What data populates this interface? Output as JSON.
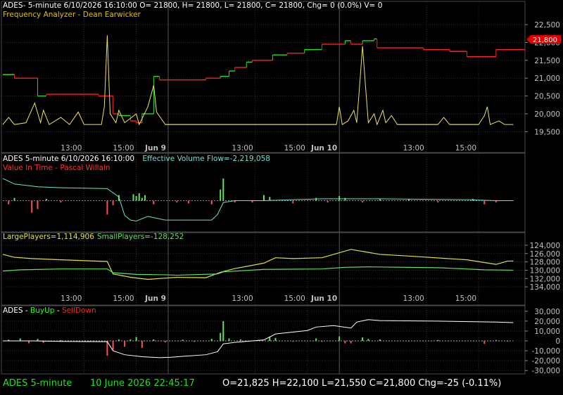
{
  "panels": {
    "p1": {
      "header": "ADES- 5-minute 6/10/2026 16:10:00 O= 21800, H= 21800, L= 21800, C= 21800, Chg= 0 (0.0%) V= 0",
      "indicator_label": "Frequency Analyzer - Dean Earwicker",
      "price_badge": "21,800"
    },
    "p2": {
      "header_prefix": "ADES 5-minute  6/10/2026 16:10:00",
      "header_indicator": "Effective Volume Flow=-2,219,058",
      "indicator_label": "Value In Time - Pascal Willain"
    },
    "p3": {
      "large_label": "LargePlayers=1,114,906",
      "small_label": "SmallPlayers=-128,252"
    },
    "p4": {
      "name": "ADES - ",
      "buy_label": "BuyUp",
      "dash": "-",
      "sell_label": "SellDown"
    }
  },
  "status_bar": {
    "symbol": "ADES  5-minute",
    "datetime": "10 June 2026 22:45:17",
    "ohlc": "O=21,825  H=22,100  L=21,550  C=21,800  Chg=-25 (-0.11%)"
  },
  "colors": {
    "background": "#000000",
    "grid": "#333333",
    "axis_text": "#c0c0c0",
    "price_red": "#ff2020",
    "price_green": "#20e020",
    "oscillator_yellow": "#f0e060",
    "label_yellow": "#e0c000",
    "volume_flow_cyan": "#70e0d0",
    "value_in_time_red": "#ff3030",
    "large_players_yellow": "#e0e040",
    "small_players_green": "#60e060",
    "buyup_green": "#20ff20",
    "selldown_red": "#ff2020",
    "bar_green": "#60e060",
    "bar_red": "#ff5050",
    "white_line": "#ffffff"
  },
  "chart_data": [
    {
      "type": "line",
      "name": "price-panel",
      "ylim": [
        19250,
        22600
      ],
      "y_ticks": [
        "22,500",
        "22,000",
        "21,500",
        "21,000",
        "20,500",
        "20,000",
        "19,500"
      ],
      "y_tick_values": [
        22500,
        22000,
        21500,
        21000,
        20500,
        20000,
        19500
      ],
      "x_ticks": [
        "13:00",
        "15:00",
        "Jun 9",
        "13:00",
        "15:00",
        "Jun 10",
        "13:00",
        "15:00"
      ],
      "x_tick_bars": [
        28,
        46,
        57,
        87,
        105,
        116,
        146,
        164
      ],
      "n_bars": 180,
      "day_boundaries": [
        57,
        116
      ],
      "price_steps": [
        {
          "x": 0,
          "y": 21100,
          "c": "green"
        },
        {
          "x": 4,
          "y": 21000,
          "c": "red"
        },
        {
          "x": 12,
          "y": 20500,
          "c": "green"
        },
        {
          "x": 15,
          "y": 20550,
          "c": "red"
        },
        {
          "x": 33,
          "y": 20500,
          "c": "red"
        },
        {
          "x": 38,
          "y": 20000,
          "c": "red"
        },
        {
          "x": 40,
          "y": 19950,
          "c": "green"
        },
        {
          "x": 44,
          "y": 19800,
          "c": "red"
        },
        {
          "x": 46,
          "y": 19750,
          "c": "red"
        },
        {
          "x": 48,
          "y": 20000,
          "c": "green"
        },
        {
          "x": 52,
          "y": 21050,
          "c": "green"
        },
        {
          "x": 54,
          "y": 20950,
          "c": "red"
        },
        {
          "x": 62,
          "y": 20950,
          "c": "red"
        },
        {
          "x": 70,
          "y": 21000,
          "c": "red"
        },
        {
          "x": 75,
          "y": 21050,
          "c": "green"
        },
        {
          "x": 78,
          "y": 21200,
          "c": "green"
        },
        {
          "x": 80,
          "y": 21300,
          "c": "red"
        },
        {
          "x": 84,
          "y": 21450,
          "c": "green"
        },
        {
          "x": 86,
          "y": 21500,
          "c": "red"
        },
        {
          "x": 93,
          "y": 21650,
          "c": "green"
        },
        {
          "x": 98,
          "y": 21700,
          "c": "red"
        },
        {
          "x": 104,
          "y": 21800,
          "c": "green"
        },
        {
          "x": 110,
          "y": 21950,
          "c": "red"
        },
        {
          "x": 118,
          "y": 22050,
          "c": "green"
        },
        {
          "x": 120,
          "y": 21950,
          "c": "red"
        },
        {
          "x": 124,
          "y": 22050,
          "c": "green"
        },
        {
          "x": 128,
          "y": 22100,
          "c": "green"
        },
        {
          "x": 129,
          "y": 21850,
          "c": "red"
        },
        {
          "x": 145,
          "y": 21800,
          "c": "red"
        },
        {
          "x": 154,
          "y": 21750,
          "c": "red"
        },
        {
          "x": 160,
          "y": 21600,
          "c": "red"
        },
        {
          "x": 170,
          "y": 21800,
          "c": "red"
        },
        {
          "x": 180,
          "y": 21800,
          "c": "red"
        }
      ],
      "oscillator_spikes": [
        {
          "x": 0,
          "y": 19700
        },
        {
          "x": 2,
          "y": 19900
        },
        {
          "x": 4,
          "y": 19700
        },
        {
          "x": 8,
          "y": 19750
        },
        {
          "x": 11,
          "y": 20300
        },
        {
          "x": 13,
          "y": 19750
        },
        {
          "x": 14,
          "y": 20100
        },
        {
          "x": 16,
          "y": 19700
        },
        {
          "x": 20,
          "y": 19900
        },
        {
          "x": 23,
          "y": 19700
        },
        {
          "x": 26,
          "y": 20050
        },
        {
          "x": 28,
          "y": 19700
        },
        {
          "x": 34,
          "y": 19700
        },
        {
          "x": 35,
          "y": 20200
        },
        {
          "x": 36,
          "y": 22200
        },
        {
          "x": 37,
          "y": 20000
        },
        {
          "x": 39,
          "y": 19750
        },
        {
          "x": 40,
          "y": 20100
        },
        {
          "x": 42,
          "y": 19750
        },
        {
          "x": 46,
          "y": 20000
        },
        {
          "x": 47,
          "y": 19700
        },
        {
          "x": 50,
          "y": 20200
        },
        {
          "x": 52,
          "y": 20800
        },
        {
          "x": 53,
          "y": 20050
        },
        {
          "x": 56,
          "y": 19700
        },
        {
          "x": 115,
          "y": 19700
        },
        {
          "x": 116,
          "y": 20200
        },
        {
          "x": 117,
          "y": 19700
        },
        {
          "x": 119,
          "y": 19800
        },
        {
          "x": 121,
          "y": 20100
        },
        {
          "x": 122,
          "y": 19750
        },
        {
          "x": 123,
          "y": 20800
        },
        {
          "x": 124,
          "y": 21900
        },
        {
          "x": 125,
          "y": 20800
        },
        {
          "x": 126,
          "y": 19750
        },
        {
          "x": 128,
          "y": 20000
        },
        {
          "x": 129,
          "y": 19700
        },
        {
          "x": 131,
          "y": 20100
        },
        {
          "x": 132,
          "y": 19750
        },
        {
          "x": 134,
          "y": 19950
        },
        {
          "x": 136,
          "y": 19700
        },
        {
          "x": 150,
          "y": 19700
        },
        {
          "x": 152,
          "y": 19900
        },
        {
          "x": 154,
          "y": 19700
        },
        {
          "x": 164,
          "y": 19700
        },
        {
          "x": 166,
          "y": 19950
        },
        {
          "x": 167,
          "y": 20200
        },
        {
          "x": 168,
          "y": 19700
        },
        {
          "x": 171,
          "y": 19800
        },
        {
          "x": 173,
          "y": 19700
        },
        {
          "x": 176,
          "y": 19700
        }
      ]
    },
    {
      "type": "line",
      "name": "volume-flow-panel",
      "ylim": [
        -3,
        3
      ],
      "x_ticks": [],
      "volume_flow": [
        {
          "x": 0,
          "y": 2.4
        },
        {
          "x": 4,
          "y": 1.8
        },
        {
          "x": 12,
          "y": 1.5
        },
        {
          "x": 20,
          "y": 1.4
        },
        {
          "x": 36,
          "y": 1.3
        },
        {
          "x": 40,
          "y": 0.4
        },
        {
          "x": 42,
          "y": -1.6
        },
        {
          "x": 44,
          "y": -2.1
        },
        {
          "x": 46,
          "y": -2.2
        },
        {
          "x": 50,
          "y": -1.7
        },
        {
          "x": 53,
          "y": -1.9
        },
        {
          "x": 56,
          "y": -2.1
        },
        {
          "x": 60,
          "y": -2.1
        },
        {
          "x": 72,
          "y": -2.1
        },
        {
          "x": 74,
          "y": -1.5
        },
        {
          "x": 76,
          "y": -0.2
        },
        {
          "x": 80,
          "y": 0.0
        },
        {
          "x": 90,
          "y": 0.0
        },
        {
          "x": 110,
          "y": 0.2
        },
        {
          "x": 130,
          "y": 0.2
        },
        {
          "x": 160,
          "y": 0.1
        },
        {
          "x": 170,
          "y": 0.0
        },
        {
          "x": 176,
          "y": 0.0
        }
      ],
      "bars": [
        {
          "x": 2,
          "v": -0.4
        },
        {
          "x": 4,
          "v": 0.3
        },
        {
          "x": 10,
          "v": -1.3
        },
        {
          "x": 12,
          "v": -0.9
        },
        {
          "x": 15,
          "v": 0.2
        },
        {
          "x": 20,
          "v": -0.2
        },
        {
          "x": 36,
          "v": -1.5
        },
        {
          "x": 38,
          "v": -0.5
        },
        {
          "x": 40,
          "v": 0.6
        },
        {
          "x": 45,
          "v": 0.7
        },
        {
          "x": 46,
          "v": 0.5
        },
        {
          "x": 47,
          "v": 0.8
        },
        {
          "x": 48,
          "v": 0.3
        },
        {
          "x": 49,
          "v": 0.6
        },
        {
          "x": 52,
          "v": -0.4
        },
        {
          "x": 60,
          "v": -0.2
        },
        {
          "x": 64,
          "v": -0.3
        },
        {
          "x": 72,
          "v": -0.4
        },
        {
          "x": 75,
          "v": 1.2
        },
        {
          "x": 76,
          "v": 2.4
        },
        {
          "x": 80,
          "v": -0.2
        },
        {
          "x": 86,
          "v": -0.2
        },
        {
          "x": 90,
          "v": 0.6
        },
        {
          "x": 92,
          "v": 0.4
        },
        {
          "x": 100,
          "v": -0.3
        },
        {
          "x": 108,
          "v": 0.3
        },
        {
          "x": 112,
          "v": -0.2
        },
        {
          "x": 116,
          "v": 0.5
        },
        {
          "x": 118,
          "v": 0.3
        },
        {
          "x": 124,
          "v": -0.2
        },
        {
          "x": 130,
          "v": 0.2
        },
        {
          "x": 140,
          "v": 0.2
        },
        {
          "x": 150,
          "v": -0.2
        },
        {
          "x": 162,
          "v": 0.2
        },
        {
          "x": 166,
          "v": -0.4
        },
        {
          "x": 170,
          "v": -0.2
        }
      ]
    },
    {
      "type": "line",
      "name": "players-panel",
      "ylim": [
        135500,
        123000
      ],
      "y_ticks": [
        "124,000",
        "126,000",
        "128,000",
        "130,000",
        "132,000",
        "134,000"
      ],
      "y_tick_values": [
        124000,
        126000,
        128000,
        130000,
        132000,
        134000
      ],
      "x_ticks": [
        "13:00",
        "15:00",
        "Jun 9",
        "13:00",
        "15:00",
        "Jun 10",
        "13:00",
        "15:00"
      ],
      "x_tick_bars": [
        28,
        46,
        57,
        87,
        105,
        116,
        146,
        164
      ],
      "large_players": [
        {
          "x": 0,
          "y": 126200
        },
        {
          "x": 4,
          "y": 126900
        },
        {
          "x": 10,
          "y": 127200
        },
        {
          "x": 20,
          "y": 127500
        },
        {
          "x": 36,
          "y": 127900
        },
        {
          "x": 38,
          "y": 130900
        },
        {
          "x": 44,
          "y": 131700
        },
        {
          "x": 50,
          "y": 132200
        },
        {
          "x": 56,
          "y": 131900
        },
        {
          "x": 60,
          "y": 131700
        },
        {
          "x": 70,
          "y": 131800
        },
        {
          "x": 75,
          "y": 130500
        },
        {
          "x": 80,
          "y": 129600
        },
        {
          "x": 90,
          "y": 128300
        },
        {
          "x": 94,
          "y": 127000
        },
        {
          "x": 100,
          "y": 127200
        },
        {
          "x": 110,
          "y": 127000
        },
        {
          "x": 120,
          "y": 125000
        },
        {
          "x": 125,
          "y": 125600
        },
        {
          "x": 130,
          "y": 126200
        },
        {
          "x": 140,
          "y": 126600
        },
        {
          "x": 160,
          "y": 127500
        },
        {
          "x": 170,
          "y": 128600
        },
        {
          "x": 174,
          "y": 127800
        },
        {
          "x": 176,
          "y": 127800
        }
      ],
      "small_players": [
        {
          "x": 0,
          "y": 130200
        },
        {
          "x": 6,
          "y": 129900
        },
        {
          "x": 20,
          "y": 129700
        },
        {
          "x": 36,
          "y": 129700
        },
        {
          "x": 38,
          "y": 130600
        },
        {
          "x": 46,
          "y": 131000
        },
        {
          "x": 56,
          "y": 131100
        },
        {
          "x": 60,
          "y": 131200
        },
        {
          "x": 74,
          "y": 130900
        },
        {
          "x": 76,
          "y": 130400
        },
        {
          "x": 90,
          "y": 129800
        },
        {
          "x": 110,
          "y": 129700
        },
        {
          "x": 118,
          "y": 129300
        },
        {
          "x": 126,
          "y": 129200
        },
        {
          "x": 150,
          "y": 129400
        },
        {
          "x": 166,
          "y": 129900
        },
        {
          "x": 176,
          "y": 130000
        }
      ]
    },
    {
      "type": "bar",
      "name": "buyup-selldown-panel",
      "ylim": [
        -32000,
        32000
      ],
      "y_ticks": [
        "30,000",
        "20,000",
        "10,000",
        "0",
        "-10,000",
        "-20,000",
        "-30,000"
      ],
      "y_tick_values": [
        30000,
        20000,
        10000,
        0,
        -10000,
        -20000,
        -30000
      ],
      "cumulative": [
        {
          "x": 0,
          "y": 0
        },
        {
          "x": 10,
          "y": 0
        },
        {
          "x": 20,
          "y": -500
        },
        {
          "x": 36,
          "y": -800
        },
        {
          "x": 38,
          "y": -10000
        },
        {
          "x": 42,
          "y": -14000
        },
        {
          "x": 48,
          "y": -16000
        },
        {
          "x": 54,
          "y": -17000
        },
        {
          "x": 58,
          "y": -16500
        },
        {
          "x": 70,
          "y": -14000
        },
        {
          "x": 74,
          "y": -11000
        },
        {
          "x": 76,
          "y": -3000
        },
        {
          "x": 80,
          "y": -1500
        },
        {
          "x": 90,
          "y": 1000
        },
        {
          "x": 94,
          "y": 7000
        },
        {
          "x": 105,
          "y": 10500
        },
        {
          "x": 108,
          "y": 14000
        },
        {
          "x": 114,
          "y": 15500
        },
        {
          "x": 120,
          "y": 13000
        },
        {
          "x": 122,
          "y": 19000
        },
        {
          "x": 126,
          "y": 21500
        },
        {
          "x": 130,
          "y": 20500
        },
        {
          "x": 150,
          "y": 20000
        },
        {
          "x": 170,
          "y": 19000
        },
        {
          "x": 176,
          "y": 18500
        }
      ],
      "bars": [
        {
          "x": 2,
          "v": 1200
        },
        {
          "x": 6,
          "v": 2500
        },
        {
          "x": 9,
          "v": -2500
        },
        {
          "x": 12,
          "v": 2000
        },
        {
          "x": 14,
          "v": -2000
        },
        {
          "x": 20,
          "v": 800
        },
        {
          "x": 30,
          "v": -700
        },
        {
          "x": 36,
          "v": -15000
        },
        {
          "x": 38,
          "v": -9000
        },
        {
          "x": 40,
          "v": 1500
        },
        {
          "x": 42,
          "v": -6000
        },
        {
          "x": 44,
          "v": 1500
        },
        {
          "x": 46,
          "v": 4000
        },
        {
          "x": 48,
          "v": -7000
        },
        {
          "x": 52,
          "v": 1500
        },
        {
          "x": 56,
          "v": -1500
        },
        {
          "x": 62,
          "v": 1200
        },
        {
          "x": 66,
          "v": -1000
        },
        {
          "x": 72,
          "v": 2000
        },
        {
          "x": 75,
          "v": 8000
        },
        {
          "x": 76,
          "v": 20000
        },
        {
          "x": 78,
          "v": 2500
        },
        {
          "x": 82,
          "v": 1500
        },
        {
          "x": 88,
          "v": 1000
        },
        {
          "x": 92,
          "v": 4000
        },
        {
          "x": 94,
          "v": 3000
        },
        {
          "x": 100,
          "v": -1000
        },
        {
          "x": 108,
          "v": 2500
        },
        {
          "x": 110,
          "v": -1000
        },
        {
          "x": 116,
          "v": 4500
        },
        {
          "x": 118,
          "v": -2500
        },
        {
          "x": 120,
          "v": -2500
        },
        {
          "x": 124,
          "v": 3500
        },
        {
          "x": 126,
          "v": 2000
        },
        {
          "x": 130,
          "v": 1500
        },
        {
          "x": 140,
          "v": -800
        },
        {
          "x": 150,
          "v": 900
        },
        {
          "x": 166,
          "v": -3000
        },
        {
          "x": 170,
          "v": 900
        },
        {
          "x": 174,
          "v": -600
        }
      ]
    }
  ]
}
